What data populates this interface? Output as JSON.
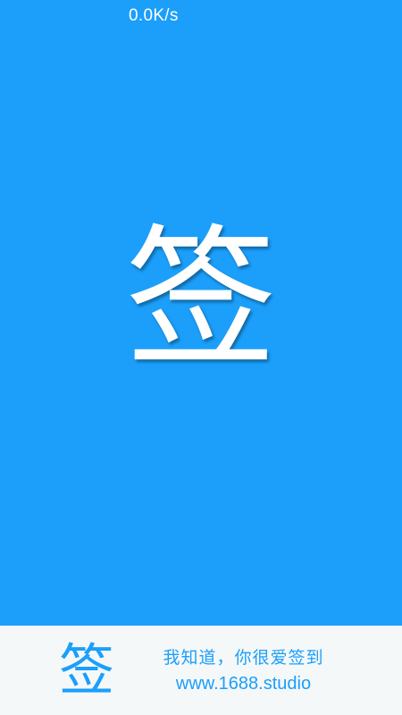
{
  "status_bar": {
    "net_speed": "0.0K/s"
  },
  "splash": {
    "logo_char": "签"
  },
  "footer": {
    "logo_char": "签",
    "slogan": "我知道，你很爱签到",
    "website": "www.1688.studio"
  },
  "colors": {
    "brand": "#1b9ffb",
    "footer_bg": "#f5f8f8",
    "text_light": "#ffffff"
  }
}
